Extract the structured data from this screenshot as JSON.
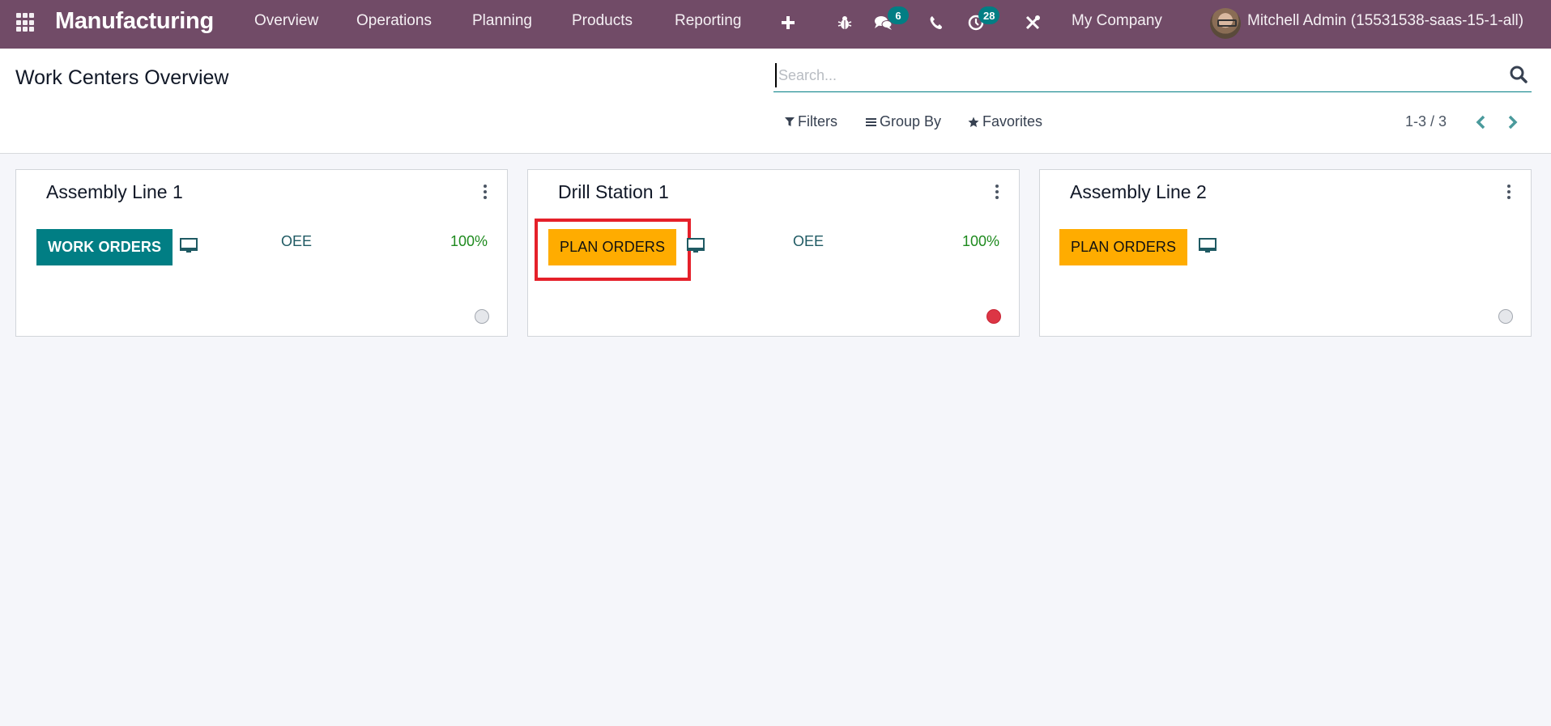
{
  "navbar": {
    "app_name": "Manufacturing",
    "menus": [
      "Overview",
      "Operations",
      "Planning",
      "Products",
      "Reporting"
    ],
    "icons": {
      "apps": "apps-grid-icon",
      "quick_create": "plus-icon",
      "debug": "bug-icon",
      "messages": "chat-icon",
      "phone": "phone-icon",
      "activities": "clock-icon",
      "settings": "tools-icon"
    },
    "messages_count": "6",
    "activities_count": "28",
    "company": "My Company",
    "user": "Mitchell Admin (15531538-saas-15-1-all)"
  },
  "control_panel": {
    "title": "Work Centers Overview",
    "search_placeholder": "Search...",
    "search_value": "",
    "filters_label": "Filters",
    "group_by_label": "Group By",
    "favorites_label": "Favorites",
    "pager": "1-3 / 3"
  },
  "cards": [
    {
      "name": "Assembly Line 1",
      "button": "WORK ORDERS",
      "button_style": "teal",
      "oee_label": "OEE",
      "oee_value": "100%",
      "status": "grey",
      "highlighted": false
    },
    {
      "name": "Drill Station 1",
      "button": "PLAN ORDERS",
      "button_style": "amber",
      "oee_label": "OEE",
      "oee_value": "100%",
      "status": "red",
      "highlighted": true
    },
    {
      "name": "Assembly Line 2",
      "button": "PLAN ORDERS",
      "button_style": "amber",
      "oee_label": "",
      "oee_value": "",
      "status": "grey",
      "highlighted": false
    }
  ],
  "colors": {
    "navbar": "#714b67",
    "accent": "#017e84",
    "amber": "#ffac00",
    "oee_green": "#1e8a1e",
    "status_red": "#dc3545",
    "highlight": "#e5202a"
  }
}
